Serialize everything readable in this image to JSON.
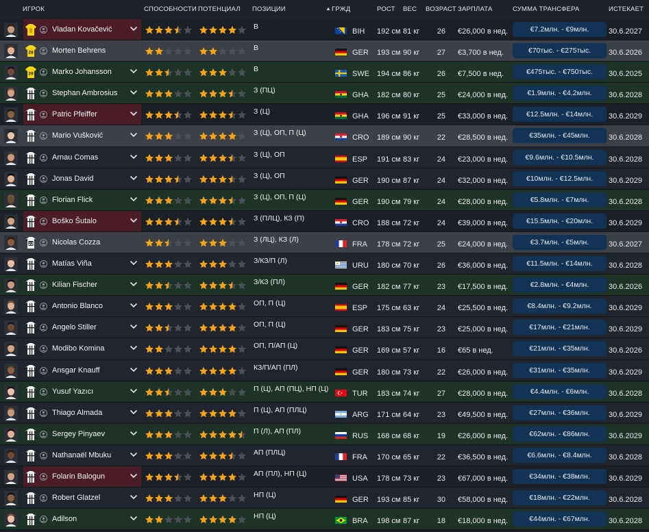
{
  "columns": {
    "player": "ИГРОК",
    "ability": "СПОСОБНОСТИ",
    "potential": "ПОТЕНЦИАЛ",
    "positions": "ПОЗИЦИИ",
    "nationality": "ГРЖД",
    "height": "РОСТ",
    "weight": "ВЕС",
    "age": "ВОЗРАСТ",
    "wage": "ЗАРПЛАТА",
    "transfer": "СУММА ТРАНСФЕРА",
    "expires": "ИСТЕКАЕТ"
  },
  "colors": {
    "star_filled": "#f2a31a",
    "star_empty": "#4b4f56",
    "fee_bg": "#123354",
    "row_green": "#1e3327",
    "row_grey": "#3c4047",
    "row_red": "#4a1c27"
  },
  "players": [
    {
      "name": "Vladan Kovačević",
      "kit": "gk",
      "kit_number": "",
      "ability": 3.5,
      "potential": 4.0,
      "positions": "В",
      "flag": "BIH",
      "nat": "BIH",
      "height": "192 см",
      "weight": "81 кг",
      "age": "26",
      "wage": "€26,000 в нед.",
      "fee": "€7.2млн. - €9млн.",
      "expires": "30.6.2027",
      "bg": "red",
      "chevron": true
    },
    {
      "name": "Morten Behrens",
      "kit": "gk",
      "kit_number": "28",
      "ability": 2.0,
      "potential": 2.0,
      "positions": "В",
      "flag": "GER",
      "nat": "GER",
      "height": "193 см",
      "weight": "90 кг",
      "age": "27",
      "wage": "€3,700 в нед.",
      "fee": "€70тыс. - €275тыс.",
      "expires": "30.6.2026",
      "bg": "grey",
      "chevron": false
    },
    {
      "name": "Marko Johansson",
      "kit": "gk",
      "kit_number": "29",
      "ability": 2.5,
      "potential": 3.0,
      "positions": "В",
      "flag": "SWE",
      "nat": "SWE",
      "height": "194 см",
      "weight": "86 кг",
      "age": "26",
      "wage": "€7,500 в нед.",
      "fee": "€475тыс. - €750тыс.",
      "expires": "30.6.2025",
      "bg": "green",
      "chevron": true
    },
    {
      "name": "Stephan Ambrosius",
      "kit": "field",
      "kit_number": "",
      "ability": 3.0,
      "potential": 3.5,
      "positions": "З (ПЦ)",
      "flag": "GHA",
      "nat": "GHA",
      "height": "182 см",
      "weight": "80 кг",
      "age": "25",
      "wage": "€24,000 в нед.",
      "fee": "€1.9млн. - €4.2млн.",
      "expires": "30.6.2028",
      "bg": "green",
      "chevron": true
    },
    {
      "name": "Patric Pfeiffer",
      "kit": "field",
      "kit_number": "",
      "ability": 3.5,
      "potential": 3.5,
      "positions": "З (Ц)",
      "flag": "GHA",
      "nat": "GHA",
      "height": "196 см",
      "weight": "91 кг",
      "age": "25",
      "wage": "€33,000 в нед.",
      "fee": "€12.5млн. - €14млн.",
      "expires": "30.6.2029",
      "bg": "red",
      "chevron": true
    },
    {
      "name": "Mario Vušković",
      "kit": "field",
      "kit_number": "",
      "ability": 3.0,
      "potential": 4.0,
      "positions": "З (Ц), ОП, П (Ц)",
      "flag": "CRO",
      "nat": "CRO",
      "height": "189 см",
      "weight": "90 кг",
      "age": "22",
      "wage": "€28,500 в нед.",
      "fee": "€35млн. - €45млн.",
      "expires": "30.6.2028",
      "bg": "grey",
      "chevron": true
    },
    {
      "name": "Arnau Comas",
      "kit": "field",
      "kit_number": "",
      "ability": 3.0,
      "potential": 3.5,
      "positions": "З (Ц), ОП",
      "flag": "ESP",
      "nat": "ESP",
      "height": "191 см",
      "weight": "83 кг",
      "age": "24",
      "wage": "€23,000 в нед.",
      "fee": "€9.6млн. - €10.5млн.",
      "expires": "30.6.2028",
      "bg": "dark",
      "chevron": true
    },
    {
      "name": "Jonas David",
      "kit": "field",
      "kit_number": "",
      "ability": 3.5,
      "potential": 3.5,
      "positions": "З (Ц), ОП",
      "flag": "GER",
      "nat": "GER",
      "height": "190 см",
      "weight": "87 кг",
      "age": "24",
      "wage": "€32,000 в нед.",
      "fee": "€10млн. - €12.5млн.",
      "expires": "30.6.2029",
      "bg": "dark",
      "chevron": true
    },
    {
      "name": "Florian Flick",
      "kit": "field",
      "kit_number": "",
      "ability": 3.0,
      "potential": 3.5,
      "positions": "З (Ц), ОП, П (Ц)",
      "flag": "GER",
      "nat": "GER",
      "height": "190 см",
      "weight": "79 кг",
      "age": "24",
      "wage": "€28,000 в нед.",
      "fee": "€5.8млн. - €7млн.",
      "expires": "30.6.2028",
      "bg": "green",
      "chevron": true
    },
    {
      "name": "Boško Šutalo",
      "kit": "field",
      "kit_number": "",
      "ability": 3.5,
      "potential": 3.5,
      "positions": "З (ПЛЦ), КЗ (П)",
      "flag": "CRO",
      "nat": "CRO",
      "height": "188 см",
      "weight": "72 кг",
      "age": "24",
      "wage": "€39,000 в нед.",
      "fee": "€15.5млн. - €20млн.",
      "expires": "30.6.2029",
      "bg": "red",
      "chevron": true
    },
    {
      "name": "Nicolas Cozza",
      "kit": "field",
      "kit_number": "22",
      "ability": 2.5,
      "potential": 3.0,
      "positions": "З (ЛЦ), КЗ (Л)",
      "flag": "FRA",
      "nat": "FRA",
      "height": "178 см",
      "weight": "72 кг",
      "age": "25",
      "wage": "€24,000 в нед.",
      "fee": "€3.7млн. - €5млн.",
      "expires": "30.6.2027",
      "bg": "grey",
      "chevron": false
    },
    {
      "name": "Matías Viña",
      "kit": "field",
      "kit_number": "",
      "ability": 3.0,
      "potential": 3.0,
      "positions": "З/КЗ/П (Л)",
      "flag": "URU",
      "nat": "URU",
      "height": "180 см",
      "weight": "70 кг",
      "age": "26",
      "wage": "€36,000 в нед.",
      "fee": "€11.5млн. - €14млн.",
      "expires": "30.6.2028",
      "bg": "dark",
      "chevron": true
    },
    {
      "name": "Kilian Fischer",
      "kit": "field",
      "kit_number": "",
      "ability": 2.5,
      "potential": 3.5,
      "positions": "З/КЗ (ПЛ)",
      "flag": "GER",
      "nat": "GER",
      "height": "182 см",
      "weight": "77 кг",
      "age": "23",
      "wage": "€17,500 в нед.",
      "fee": "€2.8млн. - €4млн.",
      "expires": "30.6.2026",
      "bg": "green",
      "chevron": true
    },
    {
      "name": "Antonio Blanco",
      "kit": "field",
      "kit_number": "",
      "ability": 3.0,
      "potential": 4.0,
      "positions": "ОП, П (Ц)",
      "flag": "ESP",
      "nat": "ESP",
      "height": "175 см",
      "weight": "63 кг",
      "age": "24",
      "wage": "€25,500 в нед.",
      "fee": "€8.4млн. - €9.2млн.",
      "expires": "30.6.2029",
      "bg": "dark",
      "chevron": true
    },
    {
      "name": "Angelo Stiller",
      "kit": "field",
      "kit_number": "",
      "ability": 2.5,
      "potential": 4.0,
      "positions": "ОП, П (Ц)",
      "flag": "GER",
      "nat": "GER",
      "height": "183 см",
      "weight": "75 кг",
      "age": "23",
      "wage": "€25,000 в нед.",
      "fee": "€17млн. - €21млн.",
      "expires": "30.6.2029",
      "bg": "dark",
      "chevron": true
    },
    {
      "name": "Modibo Komina",
      "kit": "field",
      "kit_number": "",
      "ability": 2.0,
      "potential": 4.0,
      "positions": "ОП, П/АП (Ц)",
      "flag": "GER",
      "nat": "GER",
      "height": "169 см",
      "weight": "57 кг",
      "age": "16",
      "wage": "€65 в нед.",
      "fee": "€21млн. - €35млн.",
      "expires": "30.6.2026",
      "bg": "dark",
      "chevron": true
    },
    {
      "name": "Ansgar Knauff",
      "kit": "field",
      "kit_number": "",
      "ability": 3.0,
      "potential": 4.0,
      "positions": "КЗ/П/АП (ПЛ)",
      "flag": "GER",
      "nat": "GER",
      "height": "180 см",
      "weight": "73 кг",
      "age": "22",
      "wage": "€26,000 в нед.",
      "fee": "€31млн. - €35млн.",
      "expires": "30.6.2029",
      "bg": "dark",
      "chevron": true
    },
    {
      "name": "Yusuf Yazıcı",
      "kit": "field",
      "kit_number": "",
      "ability": 2.5,
      "potential": 3.0,
      "positions": "П (Ц), АП (ПЦ), НП (Ц)",
      "flag": "TUR",
      "nat": "TUR",
      "height": "183 см",
      "weight": "74 кг",
      "age": "27",
      "wage": "€28,000 в нед.",
      "fee": "€4.4млн. - €6млн.",
      "expires": "30.6.2028",
      "bg": "green",
      "chevron": true
    },
    {
      "name": "Thiago Almada",
      "kit": "field",
      "kit_number": "",
      "ability": 3.0,
      "potential": 4.0,
      "positions": "П (Ц), АП (ПЛЦ)",
      "flag": "ARG",
      "nat": "ARG",
      "height": "171 см",
      "weight": "64 кг",
      "age": "23",
      "wage": "€49,500 в нед.",
      "fee": "€27млн. - €36млн.",
      "expires": "30.6.2029",
      "bg": "dark",
      "chevron": true
    },
    {
      "name": "Sergey Pinyaev",
      "kit": "field",
      "kit_number": "",
      "ability": 3.0,
      "potential": 4.5,
      "positions": "П (Л), АП (ПЛ)",
      "flag": "RUS",
      "nat": "RUS",
      "height": "168 см",
      "weight": "68 кг",
      "age": "19",
      "wage": "€26,000 в нед.",
      "fee": "€62млн. - €86млн.",
      "expires": "30.6.2029",
      "bg": "green",
      "chevron": true
    },
    {
      "name": "Nathanaël Mbuku",
      "kit": "field",
      "kit_number": "",
      "ability": 3.0,
      "potential": 3.5,
      "positions": "АП (ПЛЦ)",
      "flag": "FRA",
      "nat": "FRA",
      "height": "170 см",
      "weight": "65 кг",
      "age": "22",
      "wage": "€36,500 в нед.",
      "fee": "€6.6млн. - €8.4млн.",
      "expires": "30.6.2028",
      "bg": "dark",
      "chevron": true
    },
    {
      "name": "Folarin Balogun",
      "kit": "field",
      "kit_number": "",
      "ability": 3.5,
      "potential": 4.0,
      "positions": "АП (ПЛ), НП (Ц)",
      "flag": "USA",
      "nat": "USA",
      "height": "178 см",
      "weight": "73 кг",
      "age": "23",
      "wage": "€67,000 в нед.",
      "fee": "€34млн. - €38млн.",
      "expires": "30.6.2029",
      "bg": "red",
      "chevron": true
    },
    {
      "name": "Robert Glatzel",
      "kit": "field",
      "kit_number": "",
      "ability": 3.0,
      "potential": 3.0,
      "positions": "НП (Ц)",
      "flag": "GER",
      "nat": "GER",
      "height": "193 см",
      "weight": "85 кг",
      "age": "30",
      "wage": "€58,000 в нед.",
      "fee": "€18млн. - €22млн.",
      "expires": "30.6.2028",
      "bg": "dark",
      "chevron": true
    },
    {
      "name": "Adilson",
      "kit": "field",
      "kit_number": "",
      "ability": 2.0,
      "potential": 4.0,
      "positions": "НП (Ц)",
      "flag": "BRA",
      "nat": "BRA",
      "height": "198 см",
      "weight": "87 кг",
      "age": "18",
      "wage": "€18,000 в нед.",
      "fee": "€44млн. - €67млн.",
      "expires": "30.6.2028",
      "bg": "green",
      "chevron": true
    }
  ]
}
